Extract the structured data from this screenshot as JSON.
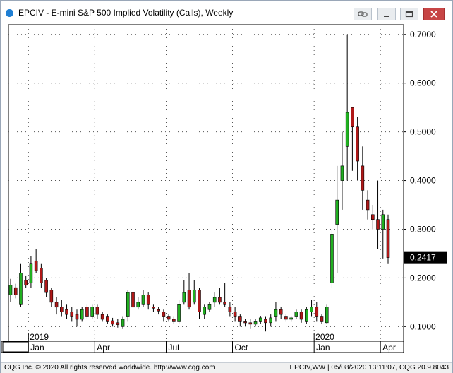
{
  "window": {
    "title": "EPCIV - E-mini S&P 500 Implied Volatility (Calls), Weekly",
    "buttons": [
      "link-icon",
      "minimize-icon",
      "maximize-icon",
      "close-icon"
    ]
  },
  "chart_data": {
    "type": "candlestick",
    "price_axis": {
      "ticks": [
        "0.7000",
        "0.6000",
        "0.5000",
        "0.4000",
        "0.3000",
        "0.2000",
        "0.1000"
      ],
      "tick_values": [
        0.7,
        0.6,
        0.5,
        0.4,
        0.3,
        0.2,
        0.1
      ],
      "range": [
        0.07,
        0.72
      ]
    },
    "last_price": "0.2417",
    "year_labels": [
      {
        "text": "2019",
        "week": 4
      },
      {
        "text": "2020",
        "week": 60
      }
    ],
    "month_labels": [
      {
        "text": "Jan",
        "week": 4
      },
      {
        "text": "Apr",
        "week": 17
      },
      {
        "text": "Jul",
        "week": 31
      },
      {
        "text": "Oct",
        "week": 44
      },
      {
        "text": "Jan",
        "week": 60
      },
      {
        "text": "Apr",
        "week": 73
      }
    ],
    "candles": [
      [
        0.165,
        0.185,
        0.198,
        0.15
      ],
      [
        0.18,
        0.165,
        0.188,
        0.158
      ],
      [
        0.145,
        0.21,
        0.23,
        0.14
      ],
      [
        0.195,
        0.185,
        0.205,
        0.18
      ],
      [
        0.19,
        0.23,
        0.245,
        0.18
      ],
      [
        0.235,
        0.215,
        0.26,
        0.21
      ],
      [
        0.22,
        0.19,
        0.23,
        0.18
      ],
      [
        0.195,
        0.17,
        0.2,
        0.16
      ],
      [
        0.175,
        0.15,
        0.18,
        0.14
      ],
      [
        0.15,
        0.14,
        0.16,
        0.125
      ],
      [
        0.14,
        0.13,
        0.155,
        0.12
      ],
      [
        0.135,
        0.125,
        0.145,
        0.115
      ],
      [
        0.13,
        0.12,
        0.14,
        0.11
      ],
      [
        0.125,
        0.115,
        0.135,
        0.1
      ],
      [
        0.115,
        0.135,
        0.14,
        0.11
      ],
      [
        0.14,
        0.12,
        0.145,
        0.115
      ],
      [
        0.12,
        0.14,
        0.145,
        0.115
      ],
      [
        0.14,
        0.125,
        0.145,
        0.115
      ],
      [
        0.125,
        0.115,
        0.13,
        0.11
      ],
      [
        0.12,
        0.11,
        0.125,
        0.105
      ],
      [
        0.112,
        0.105,
        0.118,
        0.1
      ],
      [
        0.108,
        0.104,
        0.115,
        0.098
      ],
      [
        0.1,
        0.115,
        0.12,
        0.095
      ],
      [
        0.12,
        0.17,
        0.175,
        0.11
      ],
      [
        0.17,
        0.14,
        0.18,
        0.13
      ],
      [
        0.14,
        0.15,
        0.16,
        0.135
      ],
      [
        0.145,
        0.165,
        0.175,
        0.14
      ],
      [
        0.165,
        0.145,
        0.17,
        0.135
      ],
      [
        0.14,
        0.138,
        0.145,
        0.13
      ],
      [
        0.135,
        0.132,
        0.14,
        0.125
      ],
      [
        0.13,
        0.12,
        0.135,
        0.11
      ],
      [
        0.12,
        0.115,
        0.125,
        0.11
      ],
      [
        0.115,
        0.11,
        0.12,
        0.105
      ],
      [
        0.11,
        0.145,
        0.155,
        0.105
      ],
      [
        0.15,
        0.17,
        0.195,
        0.145
      ],
      [
        0.175,
        0.14,
        0.21,
        0.135
      ],
      [
        0.15,
        0.175,
        0.195,
        0.145
      ],
      [
        0.175,
        0.13,
        0.18,
        0.115
      ],
      [
        0.125,
        0.14,
        0.145,
        0.115
      ],
      [
        0.135,
        0.145,
        0.15,
        0.13
      ],
      [
        0.15,
        0.16,
        0.17,
        0.14
      ],
      [
        0.16,
        0.15,
        0.18,
        0.145
      ],
      [
        0.15,
        0.145,
        0.19,
        0.14
      ],
      [
        0.14,
        0.13,
        0.15,
        0.12
      ],
      [
        0.13,
        0.12,
        0.14,
        0.11
      ],
      [
        0.12,
        0.11,
        0.125,
        0.1
      ],
      [
        0.11,
        0.108,
        0.115,
        0.1
      ],
      [
        0.108,
        0.105,
        0.115,
        0.095
      ],
      [
        0.105,
        0.11,
        0.115,
        0.1
      ],
      [
        0.11,
        0.118,
        0.122,
        0.105
      ],
      [
        0.115,
        0.108,
        0.12,
        0.09
      ],
      [
        0.108,
        0.118,
        0.125,
        0.1
      ],
      [
        0.12,
        0.135,
        0.15,
        0.11
      ],
      [
        0.135,
        0.125,
        0.14,
        0.115
      ],
      [
        0.12,
        0.115,
        0.125,
        0.11
      ],
      [
        0.115,
        0.118,
        0.12,
        0.11
      ],
      [
        0.12,
        0.13,
        0.135,
        0.115
      ],
      [
        0.13,
        0.115,
        0.135,
        0.108
      ],
      [
        0.11,
        0.135,
        0.14,
        0.105
      ],
      [
        0.13,
        0.14,
        0.155,
        0.12
      ],
      [
        0.14,
        0.12,
        0.15,
        0.11
      ],
      [
        0.12,
        0.11,
        0.125,
        0.105
      ],
      [
        0.108,
        0.14,
        0.145,
        0.105
      ],
      [
        0.19,
        0.29,
        0.3,
        0.18
      ],
      [
        0.31,
        0.36,
        0.43,
        0.21
      ],
      [
        0.4,
        0.43,
        0.5,
        0.34
      ],
      [
        0.47,
        0.54,
        0.7,
        0.4
      ],
      [
        0.55,
        0.51,
        0.55,
        0.42
      ],
      [
        0.51,
        0.44,
        0.53,
        0.4
      ],
      [
        0.43,
        0.38,
        0.47,
        0.34
      ],
      [
        0.36,
        0.34,
        0.38,
        0.32
      ],
      [
        0.33,
        0.32,
        0.35,
        0.3
      ],
      [
        0.32,
        0.3,
        0.4,
        0.26
      ],
      [
        0.3,
        0.33,
        0.34,
        0.24
      ],
      [
        0.32,
        0.2417,
        0.33,
        0.23
      ]
    ]
  },
  "status": {
    "left": "CQG Inc. © 2020 All rights reserved worldwide. http://www.cqg.com",
    "right": "EPCIV,WW | 05/08/2020 13:11:07, CQG 20.9.8043"
  }
}
